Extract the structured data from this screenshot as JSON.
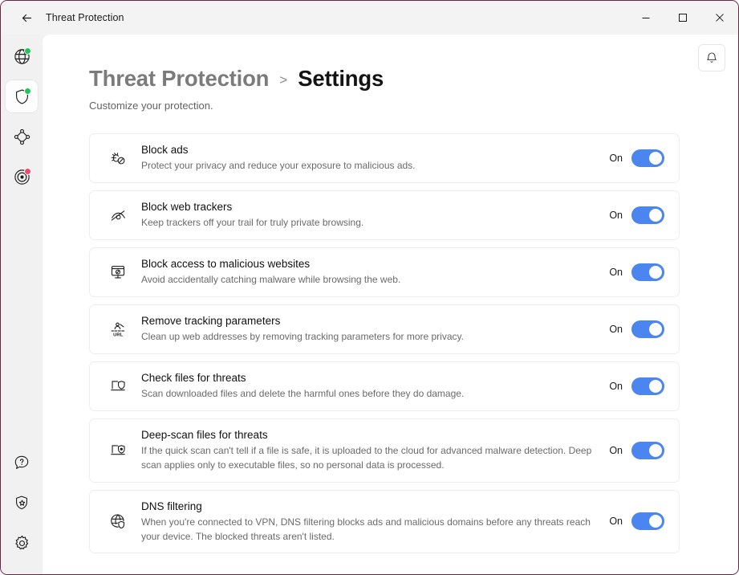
{
  "window": {
    "title": "Threat Protection",
    "back_icon": "arrow-left-icon",
    "controls": {
      "minimize": "minimize-icon",
      "maximize": "maximize-icon",
      "close": "close-icon"
    }
  },
  "sidebar": {
    "items": [
      {
        "name": "vpn",
        "icon": "globe-icon",
        "active": false,
        "dot": "green"
      },
      {
        "name": "threat-protection",
        "icon": "shield-icon",
        "active": true,
        "dot": "green"
      },
      {
        "name": "meshnet",
        "icon": "meshnet-icon",
        "active": false,
        "dot": "none"
      },
      {
        "name": "dark-web-monitor",
        "icon": "radar-icon",
        "active": false,
        "dot": "red"
      }
    ],
    "bottom_items": [
      {
        "name": "help",
        "icon": "help-bubble-icon"
      },
      {
        "name": "rate-us",
        "icon": "shield-star-icon"
      },
      {
        "name": "settings",
        "icon": "gear-icon"
      }
    ]
  },
  "header": {
    "notification_icon": "bell-icon",
    "breadcrumb_parent": "Threat Protection",
    "breadcrumb_separator": ">",
    "breadcrumb_current": "Settings",
    "subtitle": "Customize your protection."
  },
  "colors": {
    "toggle_on": "#4a85f0",
    "active_indicator": "#3b7deb",
    "status_green": "#1ec65a",
    "status_red": "#f4476b",
    "window_border": "#6d2348"
  },
  "settings": [
    {
      "id": "block-ads",
      "icon": "bug-blocked-icon",
      "title": "Block ads",
      "description": "Protect your privacy and reduce your exposure to malicious ads.",
      "toggle_label": "On",
      "toggle_state": "on"
    },
    {
      "id": "block-web-trackers",
      "icon": "eye-off-icon",
      "title": "Block web trackers",
      "description": "Keep trackers off your trail for truly private browsing.",
      "toggle_label": "On",
      "toggle_state": "on"
    },
    {
      "id": "block-malicious-websites",
      "icon": "monitor-blocked-icon",
      "title": "Block access to malicious websites",
      "description": "Avoid accidentally catching malware while browsing the web.",
      "toggle_label": "On",
      "toggle_state": "on"
    },
    {
      "id": "remove-tracking-parameters",
      "icon": "url-clean-icon",
      "title": "Remove tracking parameters",
      "description": "Clean up web addresses by removing tracking parameters for more privacy.",
      "toggle_label": "On",
      "toggle_state": "on"
    },
    {
      "id": "check-files-for-threats",
      "icon": "laptop-shield-icon",
      "title": "Check files for threats",
      "description": "Scan downloaded files and delete the harmful ones before they do damage.",
      "toggle_label": "On",
      "toggle_state": "on"
    },
    {
      "id": "deep-scan-files-for-threats",
      "icon": "laptop-shield-filled-icon",
      "title": "Deep-scan files for threats",
      "description": "If the quick scan can't tell if a file is safe, it is uploaded to the cloud for advanced malware detection. Deep scan applies only to executable files, so no personal data is processed.",
      "toggle_label": "On",
      "toggle_state": "on"
    },
    {
      "id": "dns-filtering",
      "icon": "globe-shield-icon",
      "title": "DNS filtering",
      "description": "When you're connected to VPN, DNS filtering blocks ads and malicious domains before any threats reach your device. The blocked threats aren't listed.",
      "toggle_label": "On",
      "toggle_state": "on"
    }
  ]
}
